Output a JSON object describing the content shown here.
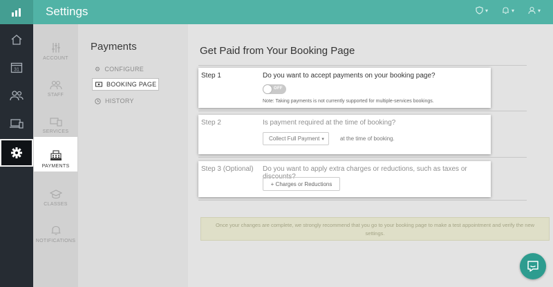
{
  "app": {
    "title": "Settings"
  },
  "rail": {
    "items": [
      "home-icon",
      "calendar-icon",
      "users-icon",
      "devices-icon",
      "settings-icon"
    ],
    "calendar_number": "31",
    "active": "settings-icon"
  },
  "subnav": {
    "items": [
      {
        "label": "ACCOUNT",
        "icon": "sliders-icon"
      },
      {
        "label": "STAFF",
        "icon": "staff-icon"
      },
      {
        "label": "SERVICES",
        "icon": "services-icon"
      },
      {
        "label": "PAYMENTS",
        "icon": "register-icon",
        "active": true
      },
      {
        "label": "CLASSES",
        "icon": "graduation-cap-icon"
      },
      {
        "label": "NOTIFICATIONS",
        "icon": "bell-icon"
      }
    ]
  },
  "payments_menu": {
    "title": "Payments",
    "items": [
      {
        "label": "CONFIGURE",
        "icon": "gear-icon"
      },
      {
        "label": "BOOKING PAGE",
        "icon": "money-icon",
        "active": true
      },
      {
        "label": "HISTORY",
        "icon": "clock-icon"
      }
    ]
  },
  "main": {
    "title": "Get Paid from Your Booking Page",
    "step1": {
      "label": "Step 1",
      "question": "Do you want to accept payments on your booking page?",
      "toggle_text": "OFF",
      "note": "Note: Taking payments is not currently supported for multiple-services bookings."
    },
    "step2": {
      "label": "Step 2",
      "question": "Is payment required at the time of booking?",
      "select_value": "Collect Full Payment",
      "after_select": "at the time of booking."
    },
    "step3": {
      "label": "Step 3 (Optional)",
      "question": "Do you want to apply extra charges or reductions, such as taxes or discounts?",
      "button": "+ Charges or Reductions"
    },
    "notice": "Once your changes are complete, we strongly recommend that you go to your booking page to make a test appointment and verify the new settings."
  },
  "colors": {
    "topbar": "#51b3a6",
    "rail": "#262c33",
    "chat": "#2d9c8f"
  }
}
